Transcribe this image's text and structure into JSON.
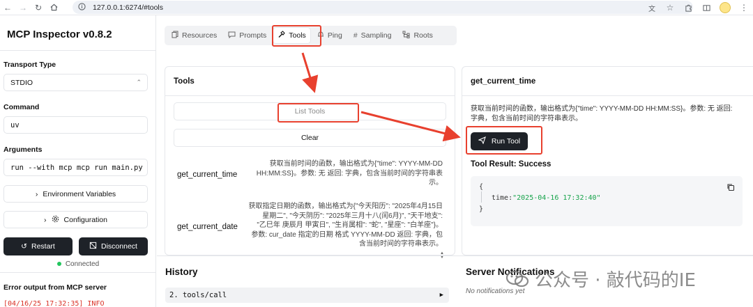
{
  "browser": {
    "url": "127.0.0.1:6274/#tools"
  },
  "sidebar": {
    "title": "MCP Inspector v0.8.2",
    "transport_label": "Transport Type",
    "transport_value": "STDIO",
    "command_label": "Command",
    "command_value": "uv",
    "arguments_label": "Arguments",
    "arguments_value": "run --with mcp mcp run main.py",
    "env_button": "Environment Variables",
    "config_button": "Configuration",
    "restart_button": "Restart",
    "disconnect_button": "Disconnect",
    "status": "Connected",
    "status_color": "#22c55e",
    "error_title": "Error output from MCP server",
    "error_line": "[04/16/25 17:32:35] INFO"
  },
  "tabs": [
    {
      "label": "Resources",
      "icon": "files-icon"
    },
    {
      "label": "Prompts",
      "icon": "chat-icon"
    },
    {
      "label": "Tools",
      "icon": "hammer-icon",
      "active": true
    },
    {
      "label": "Ping",
      "icon": "bell-icon"
    },
    {
      "label": "Sampling",
      "icon": "hash-icon"
    },
    {
      "label": "Roots",
      "icon": "tree-icon"
    }
  ],
  "tools_panel": {
    "title": "Tools",
    "list_button": "List Tools",
    "clear_button": "Clear",
    "tools": [
      {
        "name": "get_current_time",
        "desc_lines": [
          "获取当前时间的函数，输出格式为{\"time\": YYYY-MM-DD",
          "HH:MM:SS}。参数: 无 返回: 字典，包含当前时间的字符串表",
          "示。"
        ]
      },
      {
        "name": "get_current_date",
        "desc_lines": [
          "获取指定日期的函数，输出格式为{\"今天阳历\": \"2025年4月15日",
          "星期二\", \"今天阴历\": \"2025年三月十八(闰6月)\", \"天干地支\":",
          "\"乙巳年 庚辰月 甲寅日\", \"生肖属相\": \"蛇\", \"星座\": \"白羊座\"}。",
          "参数: cur_date 指定的日期 格式 YYYY-MM-DD 返回: 字典，包",
          "含当前时间的字符串表示。"
        ]
      }
    ]
  },
  "detail_panel": {
    "title": "get_current_time",
    "desc_lines": [
      "获取当前时间的函数，输出格式为{\"time\": YYYY-MM-DD HH:MM:SS}。参数: 无 返回:",
      "字典，包含当前时间的字符串表示。"
    ],
    "run_button": "Run Tool",
    "result_title": "Tool Result: Success",
    "result_open": "{",
    "result_key": "time:",
    "result_value": "\"2025-04-16 17:32:40\"",
    "result_close": "}"
  },
  "history": {
    "title": "History",
    "items": [
      "2. tools/call"
    ]
  },
  "server_notifications": {
    "title": "Server Notifications",
    "empty": "No notifications yet"
  },
  "watermark": {
    "text": "公众号 · 敲代码的IE"
  },
  "annotation_color": "#e8402e"
}
